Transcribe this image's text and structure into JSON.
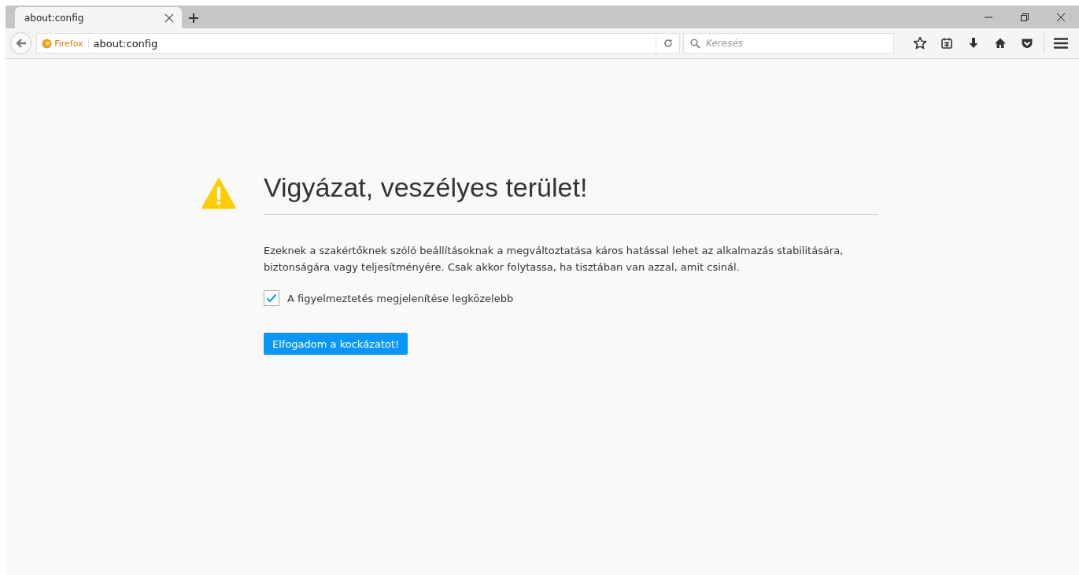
{
  "tabs": [
    {
      "title": "about:config",
      "selected": true
    }
  ],
  "toolbar": {
    "identity": "Firefox",
    "url": "about:config",
    "search_placeholder": "Keresés"
  },
  "warning": {
    "title": "Vigyázat, veszélyes terület!",
    "message": "Ezeknek a szakértőknek szóló beállításoknak a megváltoztatása káros hatással lehet az alkalmazás stabilitására, biztonságára vagy teljesítményére. Csak akkor folytassa, ha tisztában van azzal, amit csinál.",
    "checkbox": {
      "label": "A figyelmeztetés megjelenítése legközelebb",
      "checked": true
    },
    "button": "Elfogadom a kockázatot!"
  }
}
